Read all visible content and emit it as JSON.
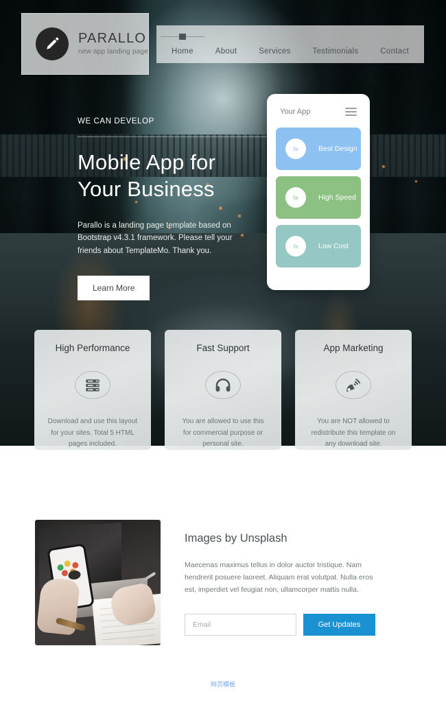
{
  "brand": {
    "logo_icon": "pencil-icon",
    "name": "PARALLO",
    "tagline": "new app landing page"
  },
  "nav": {
    "items": [
      {
        "label": "Home",
        "active": true
      },
      {
        "label": "About",
        "active": false
      },
      {
        "label": "Services",
        "active": false
      },
      {
        "label": "Testimonials",
        "active": false
      },
      {
        "label": "Contact",
        "active": false
      }
    ]
  },
  "hero": {
    "eyebrow": "WE CAN DEVELOP",
    "heading_line1": "Mobile App for",
    "heading_line2": "Your Business",
    "paragraph": "Parallo is a landing page template based on Bootstrap v4.3.1 framework. Please tell your friends about TemplateMo. Thank you.",
    "cta_label": "Learn More"
  },
  "phone_mockup": {
    "app_title": "Your App",
    "menu_icon": "hamburger-icon",
    "cards": [
      {
        "icon_text": "fa",
        "label": "Best Design",
        "color": "#8cc1f2"
      },
      {
        "icon_text": "fa",
        "label": "High Speed",
        "color": "#8cc183"
      },
      {
        "icon_text": "fa",
        "label": "Low Cost",
        "color": "#95c8c4"
      }
    ]
  },
  "features": [
    {
      "title": "High Performance",
      "icon": "server-icon",
      "text": "Download and use this layout for your sites. Total 5 HTML pages included."
    },
    {
      "title": "Fast Support",
      "icon": "headphones-icon",
      "text": "You are allowed to use this for commercial purpose or personal site."
    },
    {
      "title": "App Marketing",
      "icon": "satellite-dish-icon",
      "text": "You are NOT allowed to redistribute this template on any download site."
    }
  ],
  "unsplash": {
    "photo_alt": "hand-holding-phone-over-laptop-photo",
    "heading": "Images by Unsplash",
    "paragraph": "Maecenas maximus tellus in dolor auctor tristique. Nam hendrerit posuere laoreet. Aliquam erat volutpat. Nulla eros est, imperdiet vel feugiat non, ullamcorper mattis nulla.",
    "email_placeholder": "Email",
    "email_value": "",
    "submit_label": "Get Updates"
  },
  "footer": {
    "link_label": "网页模板"
  },
  "colors": {
    "accent_blue": "#1a91d0",
    "card_blue": "#8cc1f2",
    "card_green": "#8cc183",
    "card_teal": "#95c8c4",
    "footer_link": "#6fa8f0"
  }
}
